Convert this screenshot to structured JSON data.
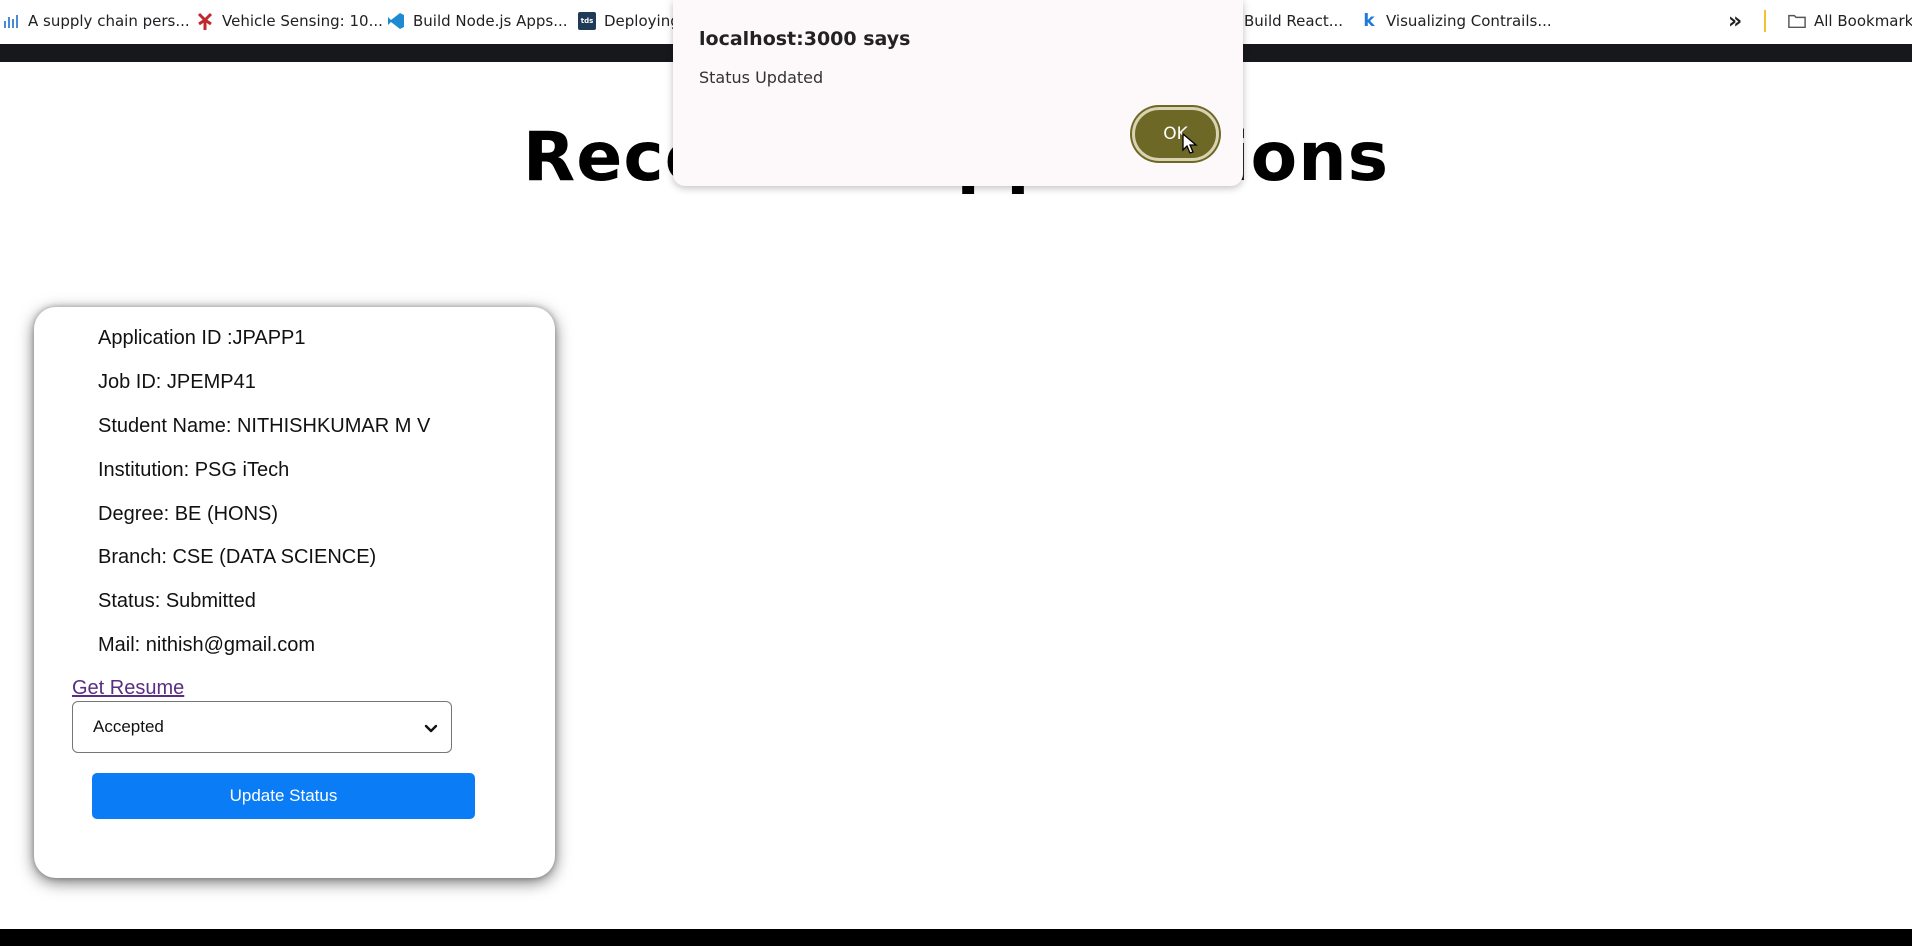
{
  "bookmarks": [
    {
      "label": "A supply chain pers...",
      "icon": "bar-chart-icon"
    },
    {
      "label": "Vehicle Sensing: 10...",
      "icon": "windmill-icon"
    },
    {
      "label": "Build Node.js Apps...",
      "icon": "vscode-icon"
    },
    {
      "label": "Deploying",
      "icon": "tds-icon"
    },
    {
      "label": "Build React...",
      "icon": ""
    },
    {
      "label": "Visualizing Contrails...",
      "icon": "k-icon"
    }
  ],
  "bookmarks_overflow": "»",
  "all_bookmarks_label": "All Bookmarks",
  "page": {
    "title": "Received Applications"
  },
  "application": {
    "application_id": "Application ID :JPAPP1",
    "job_id": "Job ID: JPEMP41",
    "student_name": "Student Name: NITHISHKUMAR M V",
    "institution": "Institution: PSG iTech",
    "degree": "Degree: BE (HONS)",
    "branch": "Branch: CSE (DATA SCIENCE)",
    "status": "Status: Submitted",
    "mail": "Mail: nithish@gmail.com",
    "resume_link": "Get Resume",
    "status_select_value": "Accepted",
    "update_button": "Update Status"
  },
  "alert": {
    "title": "localhost:3000 says",
    "message": "Status Updated",
    "ok_label": "OK"
  },
  "colors": {
    "update_button": "#0a7cf6",
    "ok_button": "#6d6826",
    "link": "#5a2d82"
  }
}
